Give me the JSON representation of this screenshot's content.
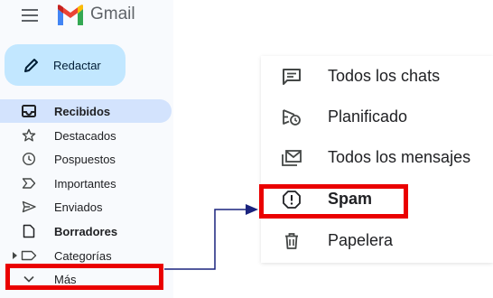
{
  "app": {
    "name": "Gmail"
  },
  "compose": {
    "label": "Redactar"
  },
  "sidebar": {
    "items": [
      {
        "label": "Recibidos",
        "icon": "inbox-icon"
      },
      {
        "label": "Destacados",
        "icon": "star-icon"
      },
      {
        "label": "Pospuestos",
        "icon": "clock-icon"
      },
      {
        "label": "Importantes",
        "icon": "important-icon"
      },
      {
        "label": "Enviados",
        "icon": "send-icon"
      },
      {
        "label": "Borradores",
        "icon": "draft-icon"
      },
      {
        "label": "Categorías",
        "icon": "label-icon"
      },
      {
        "label": "Más",
        "icon": "chevron-down-icon"
      }
    ]
  },
  "more_menu": {
    "items": [
      {
        "label": "Todos los chats",
        "icon": "chat-icon"
      },
      {
        "label": "Planificado",
        "icon": "scheduled-send-icon"
      },
      {
        "label": "Todos los mensajes",
        "icon": "all-mail-icon"
      },
      {
        "label": "Spam",
        "icon": "spam-icon"
      },
      {
        "label": "Papelera",
        "icon": "trash-icon"
      }
    ]
  },
  "colors": {
    "highlight": "#ea0000",
    "compose_bg": "#c2e7ff",
    "active_bg": "#d3e3fd",
    "arrow": "#1a237e"
  }
}
